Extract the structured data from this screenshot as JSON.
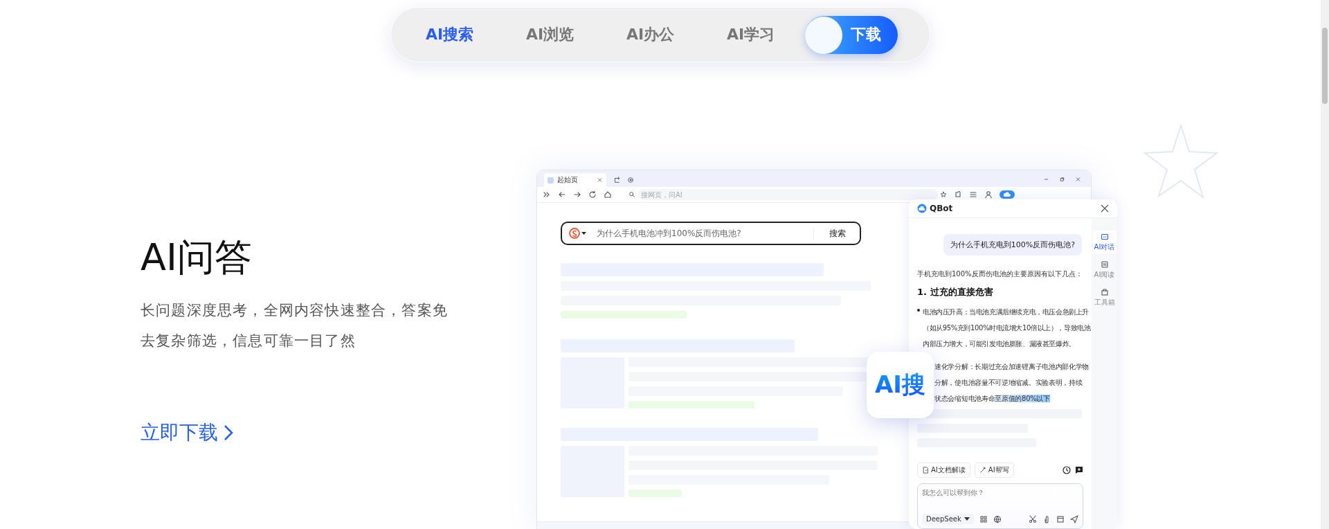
{
  "nav": {
    "tabs": [
      {
        "label": "AI搜索",
        "selected": true
      },
      {
        "label": "AI浏览",
        "selected": false
      },
      {
        "label": "AI办公",
        "selected": false
      },
      {
        "label": "AI学习",
        "selected": false
      }
    ],
    "download_button": "下载"
  },
  "feature": {
    "title": "AI问答",
    "description": "长问题深度思考，全网内容快速整合，答案免去复杂筛选，信息可靠一目了然",
    "link": "立即下载"
  },
  "browser": {
    "tab_title": "起始页",
    "address_placeholder": "搜网页，问AI",
    "search": {
      "value": "为什么手机电池冲到100%反而伤电池?",
      "button": "搜索"
    }
  },
  "qbot": {
    "title": "QBot",
    "sidebar": [
      {
        "label": "AI对话",
        "selected": true
      },
      {
        "label": "AI阅读",
        "selected": false
      },
      {
        "label": "工具箱",
        "selected": false
      }
    ],
    "question": "为什么手机充电到100%反而伤电池?",
    "intro": "手机充电到100%反而伤电池的主要原因有以下几点：",
    "heading": "1. 过充的直接危害",
    "bullet": "电池内压升高：当电池充满后继续充电，电压会急剧上升（如从95%充到100%时电流增大10倍以上），导致电池内部压力增大，可能引发电池膨胀、漏液甚至爆炸。",
    "covered_lines": [
      {
        "text": "速化学分解：长期过充会加速锂离子电池内部化学物"
      },
      {
        "text": "分解，使电池容量不可逆地缩减。实验表明，持续"
      },
      {
        "text": "状态会缩短电池寿命",
        "highlight": "至原值的80%以下"
      }
    ],
    "tools": [
      "AI文档解读",
      "AI帮写"
    ],
    "input_placeholder": "我怎么可以帮到你？",
    "model": "DeepSeek"
  },
  "badge": {
    "label": "AI搜"
  }
}
